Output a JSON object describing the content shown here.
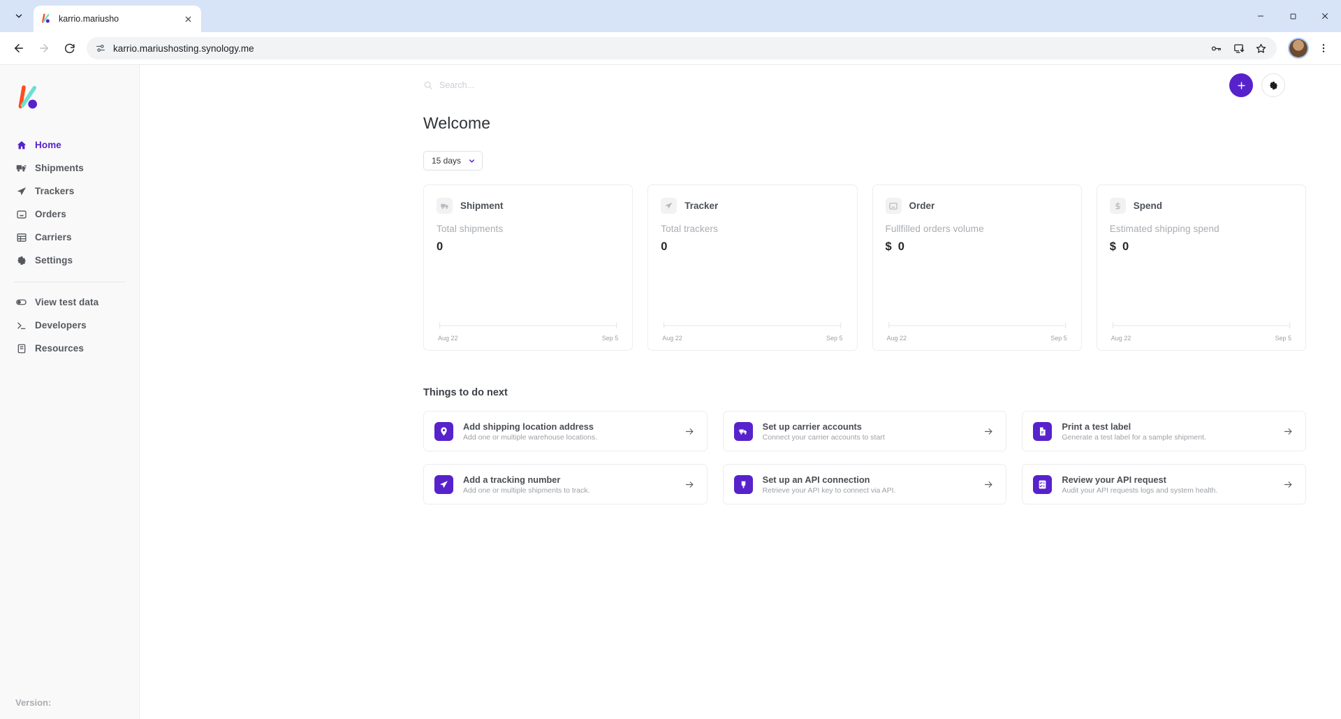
{
  "browser": {
    "tab": {
      "title": "karrio.mariusho",
      "favicon": "karrio-logo-icon",
      "close_label": "×"
    },
    "tab_list_label": "▾",
    "url": "karrio.mariushosting.synology.me",
    "nav": {
      "back": "←",
      "forward": "→",
      "reload": "⟳"
    },
    "toolbar_icons": [
      "password-key-icon",
      "install-app-icon",
      "bookmark-star-icon"
    ],
    "profile": "profile-avatar",
    "menu": "⋮",
    "window": {
      "minimize": "—",
      "maximize": "▢",
      "close": "✕"
    }
  },
  "sidebar": {
    "logo": "karrio-logo",
    "items": [
      {
        "label": "Home",
        "icon": "home-icon",
        "active": true
      },
      {
        "label": "Shipments",
        "icon": "truck-icon",
        "active": false
      },
      {
        "label": "Trackers",
        "icon": "paper-plane-icon",
        "active": false
      },
      {
        "label": "Orders",
        "icon": "inbox-icon",
        "active": false
      },
      {
        "label": "Carriers",
        "icon": "table-icon",
        "active": false
      },
      {
        "label": "Settings",
        "icon": "gear-icon",
        "active": false
      }
    ],
    "secondary_items": [
      {
        "label": "View test data",
        "icon": "toggle-switch-icon"
      },
      {
        "label": "Developers",
        "icon": "terminal-icon"
      },
      {
        "label": "Resources",
        "icon": "book-icon"
      }
    ],
    "version": "Version:"
  },
  "topbar": {
    "search_placeholder": "Search...",
    "search_value": "",
    "add_button": "+",
    "settings_button": "gear-icon"
  },
  "main": {
    "title": "Welcome",
    "range": {
      "label": "15 days",
      "chevron": "▾"
    },
    "section_title": "Things to do next"
  },
  "stats": [
    {
      "name": "Shipment",
      "icon": "truck-icon",
      "label": "Total shipments",
      "currency": "",
      "value": "0",
      "axis_start": "Aug 22",
      "axis_end": "Sep 5"
    },
    {
      "name": "Tracker",
      "icon": "paper-plane-icon",
      "label": "Total trackers",
      "currency": "",
      "value": "0",
      "axis_start": "Aug 22",
      "axis_end": "Sep 5"
    },
    {
      "name": "Order",
      "icon": "inbox-icon",
      "label": "Fullfilled orders volume",
      "currency": "$",
      "value": "0",
      "axis_start": "Aug 22",
      "axis_end": "Sep 5"
    },
    {
      "name": "Spend",
      "icon": "dollar-icon",
      "label": "Estimated shipping spend",
      "currency": "$",
      "value": "0",
      "axis_start": "Aug 22",
      "axis_end": "Sep 5"
    }
  ],
  "todos": [
    {
      "title": "Add shipping location address",
      "sub": "Add one or multiple warehouse locations.",
      "icon": "map-pin-icon",
      "arrow": "→"
    },
    {
      "title": "Set up carrier accounts",
      "sub": "Connect your carrier accounts to start",
      "icon": "delivery-truck-icon",
      "arrow": "→"
    },
    {
      "title": "Print a test label",
      "sub": "Generate a test label for a sample shipment.",
      "icon": "document-icon",
      "arrow": "→"
    },
    {
      "title": "Add a tracking number",
      "sub": "Add one or multiple shipments to track.",
      "icon": "paper-plane-icon",
      "arrow": "→"
    },
    {
      "title": "Set up an API connection",
      "sub": "Retrieve your API key to connect via API.",
      "icon": "plug-icon",
      "arrow": "→"
    },
    {
      "title": "Review your API request",
      "sub": "Audit your API requests logs and system health.",
      "icon": "checklist-icon",
      "arrow": "→"
    }
  ],
  "chart_data": {
    "type": "line",
    "title": "Sparkline trend per metric",
    "x": [
      "Aug 22",
      "Sep 5"
    ],
    "xlabel": "",
    "ylabel": "",
    "grid": false,
    "series": [
      {
        "name": "Shipment",
        "values": [
          0,
          0
        ]
      },
      {
        "name": "Tracker",
        "values": [
          0,
          0
        ]
      },
      {
        "name": "Order",
        "values": [
          0,
          0
        ]
      },
      {
        "name": "Spend",
        "values": [
          0,
          0
        ]
      }
    ]
  },
  "colors": {
    "accent": "#5722cc",
    "sidebar_bg": "#f9f9f9",
    "tabstrip_bg": "#d7e3f7",
    "text": "#4a4e54",
    "muted": "#a8acb2"
  }
}
